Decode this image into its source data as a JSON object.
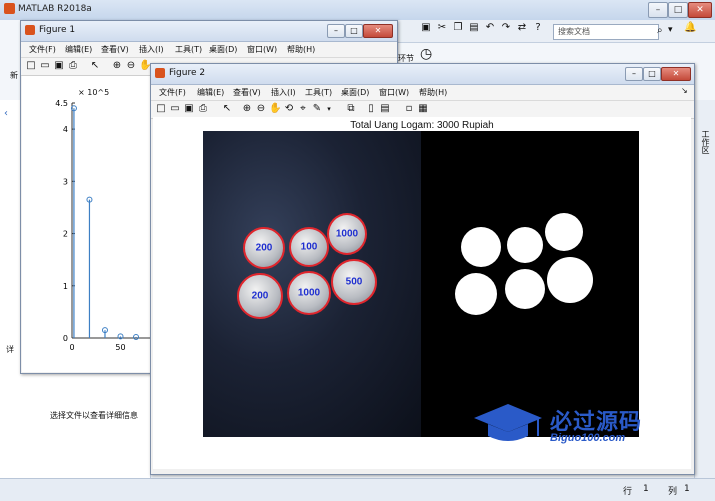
{
  "app": {
    "title": "MATLAB R2018a",
    "search_placeholder": "搜索文档"
  },
  "left_panel": {
    "detail_hint": "选择文件以查看详细信息",
    "side_label": "详"
  },
  "right_strip": {
    "label": "工作区"
  },
  "ribbon": {
    "partial_label": "新",
    "section_label": "环节"
  },
  "statusbar": {
    "row_label": "行",
    "row_value": "1",
    "col_label": "列",
    "col_value": "1"
  },
  "figure1": {
    "title": "Figure 1",
    "menus": [
      "文件(F)",
      "编辑(E)",
      "查看(V)",
      "插入(I)",
      "工具(T)",
      "桌面(D)",
      "窗口(W)",
      "帮助(H)"
    ],
    "chart_data": {
      "type": "stem",
      "y_exponent": "× 10^5",
      "y_ticks": [
        "4.5",
        "4",
        "3",
        "2",
        "1",
        "0"
      ],
      "x_ticks": [
        "0",
        "50"
      ],
      "x": [
        2,
        18,
        34,
        50,
        66
      ],
      "values": [
        4.4,
        2.65,
        0.15,
        0.03,
        0.02
      ],
      "ylim": [
        0,
        4.5
      ]
    }
  },
  "figure2": {
    "title": "Figure 2",
    "menus": [
      "文件(F)",
      "编辑(E)",
      "查看(V)",
      "插入(I)",
      "工具(T)",
      "桌面(D)",
      "窗口(W)",
      "帮助(H)"
    ],
    "plot_title": "Total Uang Logam: 3000 Rupiah",
    "coins": [
      "200",
      "100",
      "1000",
      "200",
      "1000",
      "500"
    ]
  },
  "watermark": {
    "text": "必过源码",
    "url": "Biguo100.com"
  },
  "colors": {
    "coin_border": "#e0262d",
    "coin_label": "#1f2fd0",
    "stem": "#3d7fc4"
  }
}
